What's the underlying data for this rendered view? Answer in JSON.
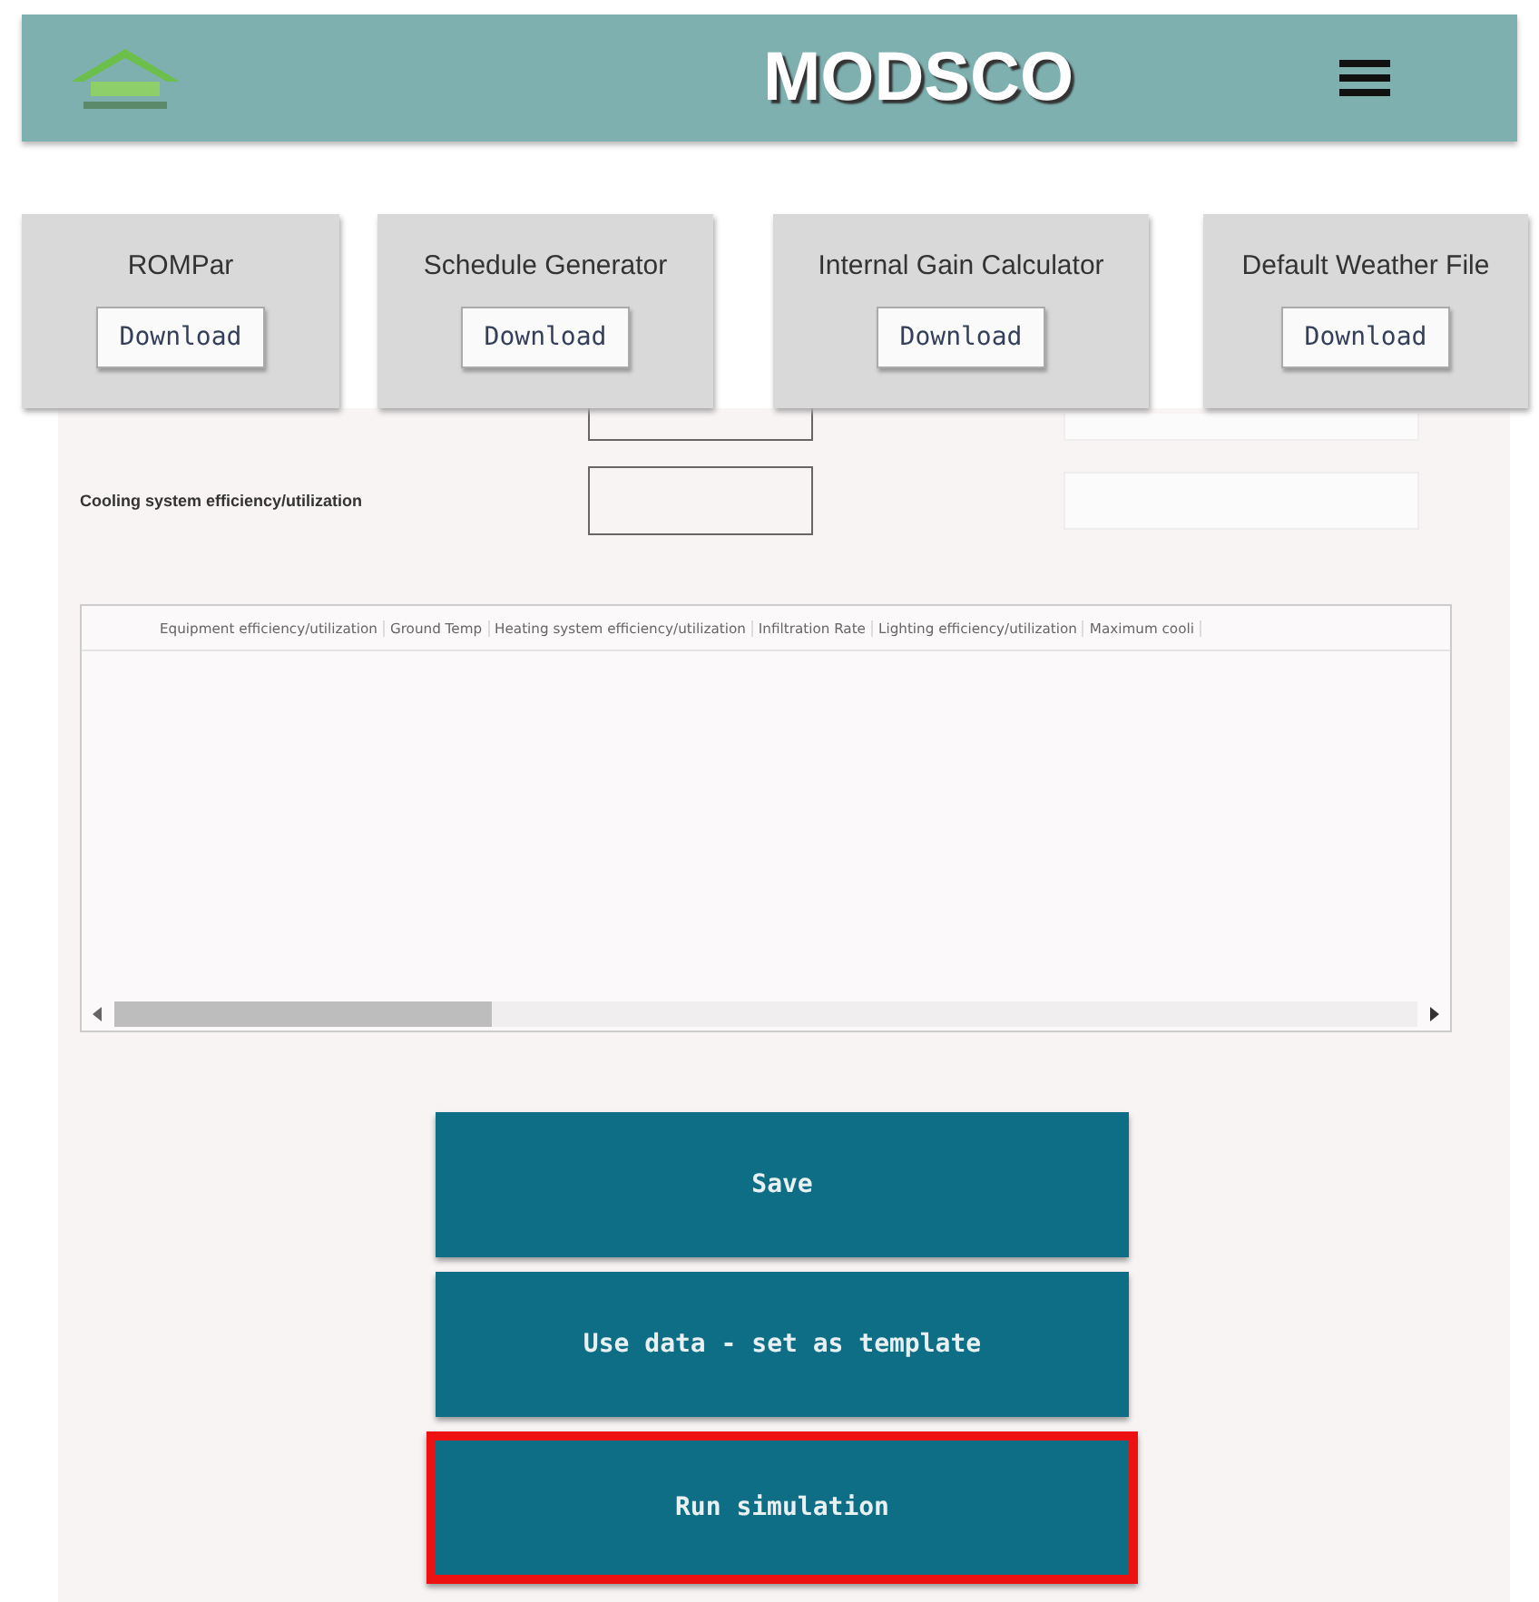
{
  "header": {
    "title": "MODSCO"
  },
  "downloads": [
    {
      "title": "ROMPar",
      "button": "Download"
    },
    {
      "title": "Schedule Generator",
      "button": "Download"
    },
    {
      "title": "Internal Gain Calculator",
      "button": "Download"
    },
    {
      "title": "Default Weather File",
      "button": "Download"
    }
  ],
  "form_rows": [
    {
      "label": "Cooling system efficiency/utilization"
    }
  ],
  "table": {
    "columns": [
      "Equipment efficiency/utilization",
      "Ground Temp",
      "Heating system efficiency/utilization",
      "Infiltration Rate",
      "Lighting efficiency/utilization",
      "Maximum cooli"
    ]
  },
  "actions": [
    {
      "label": "Save",
      "highlighted": false
    },
    {
      "label": "Use data - set as template",
      "highlighted": false
    },
    {
      "label": "Run simulation",
      "highlighted": true
    }
  ]
}
